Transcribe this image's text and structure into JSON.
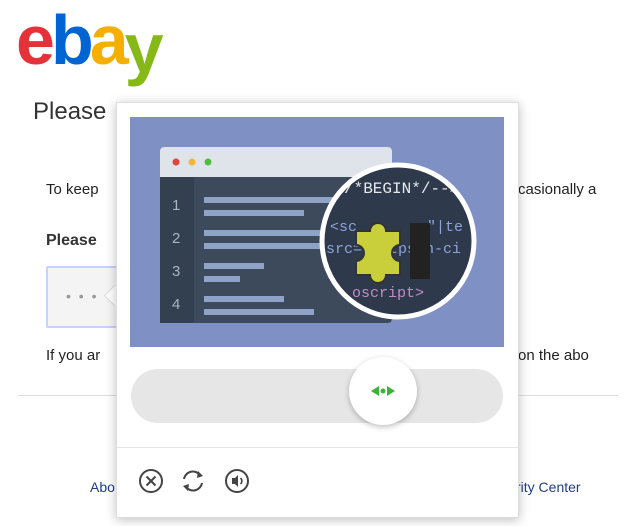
{
  "logo": {
    "letters": [
      "e",
      "b",
      "a",
      "y"
    ],
    "colors": [
      "#e53238",
      "#0064d2",
      "#f5af02",
      "#86b817"
    ]
  },
  "page": {
    "heading": "Please",
    "para1_left": "To keep",
    "para1_right": "casionally a",
    "please_bold": "Please",
    "captcha_dots": "• • •",
    "para2_left": "If you ar",
    "para2_right": "on the abo",
    "footer_left": "Abo",
    "footer_right": "rity Center"
  },
  "code": {
    "line_numbers": [
      "1",
      "2",
      "3",
      "4"
    ],
    "magnified": [
      "/*BEGIN*/-->",
      "<sc",
      "=\"|te",
      "src=\"https",
      "/n-ci",
      "oscript>"
    ]
  },
  "controls": {
    "close": "close",
    "refresh": "refresh",
    "audio": "audio"
  },
  "colors": {
    "puzzle_bg": "#7f90c4",
    "slider_arrow": "#3bb33b",
    "puzzle_piece": "#c9cf3a"
  }
}
